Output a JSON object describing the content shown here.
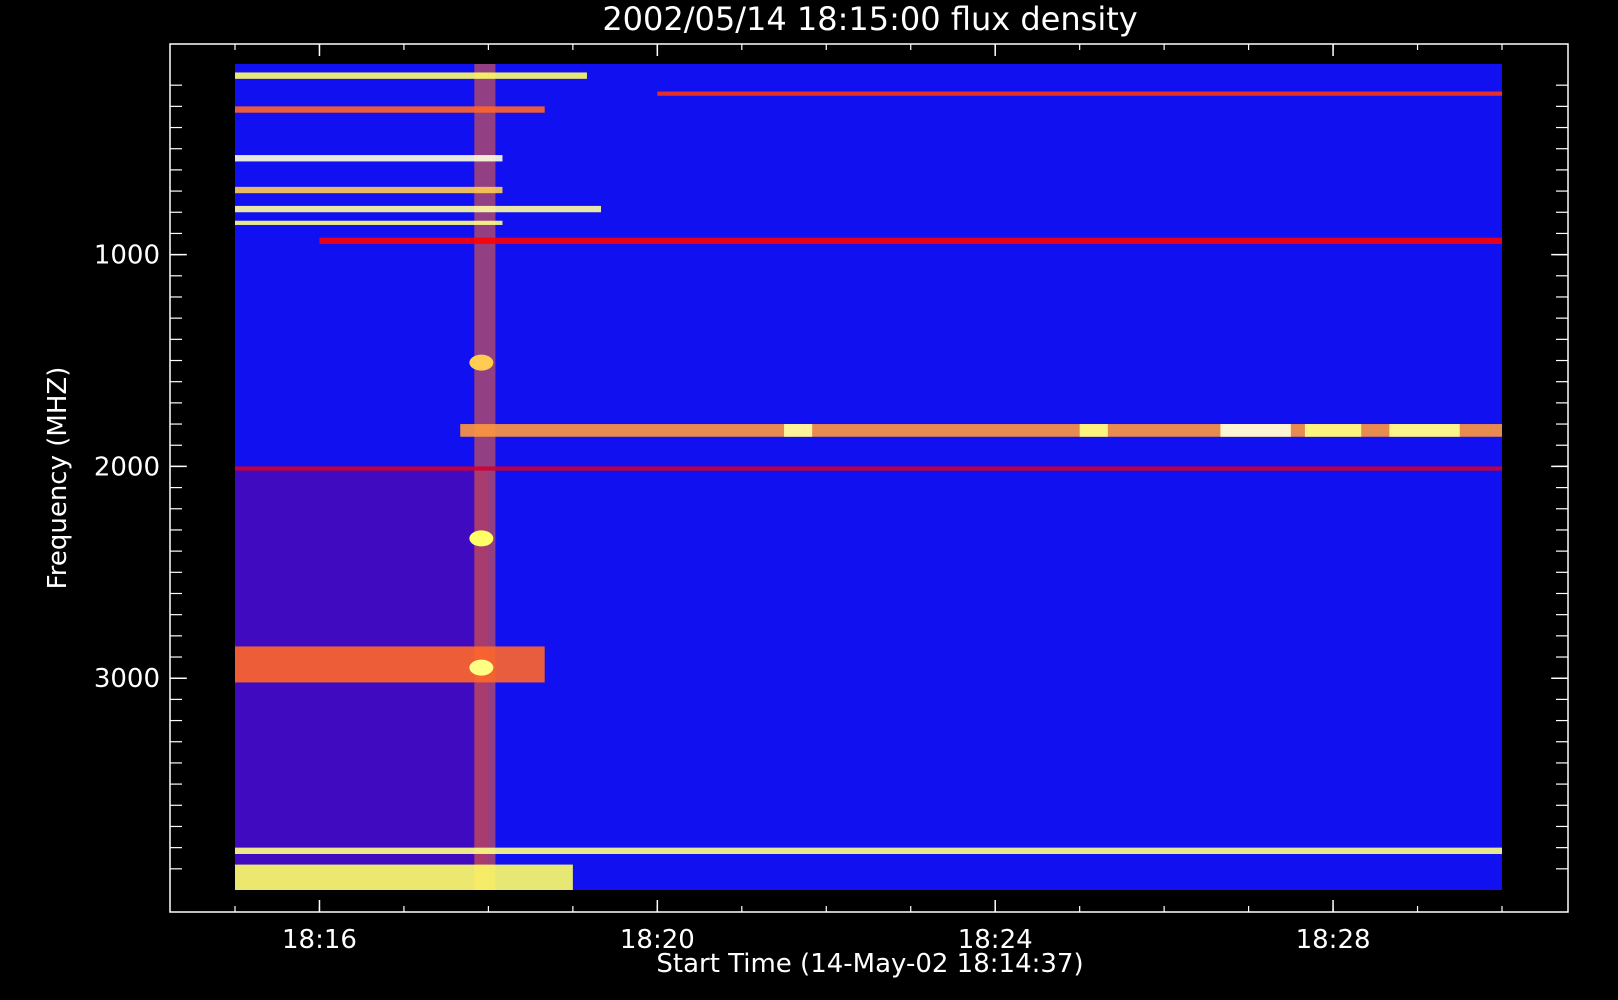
{
  "chart_data": {
    "type": "heatmap",
    "title": "2002/05/14 18:15:00 flux density",
    "xlabel": "Start Time (14-May-02 18:14:37)",
    "ylabel": "Frequency (MHZ)",
    "x_range": [
      "18:15:00",
      "18:30:00"
    ],
    "y_range_mhz": [
      100,
      4000
    ],
    "y_inverted": true,
    "x_ticks": [
      {
        "value": "18:16",
        "label": "18:16"
      },
      {
        "value": "18:20",
        "label": "18:20"
      },
      {
        "value": "18:24",
        "label": "18:24"
      },
      {
        "value": "18:28",
        "label": "18:28"
      }
    ],
    "y_ticks": [
      {
        "value": 1000,
        "label": "1000"
      },
      {
        "value": 2000,
        "label": "2000"
      },
      {
        "value": 3000,
        "label": "3000"
      }
    ],
    "colormap": [
      "#000000",
      "#0000ff",
      "#ff0000",
      "#ffff66",
      "#ffffff"
    ],
    "background_level_color": "#1010f0",
    "features": [
      {
        "kind": "horizontal-band",
        "freq_mhz": [
          140,
          170
        ],
        "time": [
          "18:15:00",
          "18:19:10"
        ],
        "intensity": 0.75
      },
      {
        "kind": "horizontal-band",
        "freq_mhz": [
          300,
          330
        ],
        "time": [
          "18:15:00",
          "18:18:40"
        ],
        "intensity": 0.6
      },
      {
        "kind": "horizontal-band",
        "freq_mhz": [
          530,
          560
        ],
        "time": [
          "18:15:00",
          "18:18:10"
        ],
        "intensity": 0.95
      },
      {
        "kind": "horizontal-band",
        "freq_mhz": [
          680,
          710
        ],
        "time": [
          "18:15:00",
          "18:18:10"
        ],
        "intensity": 0.7
      },
      {
        "kind": "horizontal-band",
        "freq_mhz": [
          770,
          800
        ],
        "time": [
          "18:15:00",
          "18:19:20"
        ],
        "intensity": 0.85
      },
      {
        "kind": "horizontal-band",
        "freq_mhz": [
          840,
          860
        ],
        "time": [
          "18:15:00",
          "18:18:10"
        ],
        "intensity": 0.8
      },
      {
        "kind": "horizontal-band",
        "freq_mhz": [
          230,
          250
        ],
        "time": [
          "18:20:00",
          "18:30:00"
        ],
        "intensity": 0.55
      },
      {
        "kind": "horizontal-band",
        "freq_mhz": [
          920,
          950
        ],
        "time": [
          "18:16:00",
          "18:30:00"
        ],
        "intensity": 0.5
      },
      {
        "kind": "horizontal-band",
        "freq_mhz": [
          1800,
          1860
        ],
        "time": [
          "18:17:40",
          "18:30:00"
        ],
        "intensity": 0.65
      },
      {
        "kind": "horizontal-band",
        "freq_mhz": [
          1800,
          1860
        ],
        "time": [
          "18:21:30",
          "18:21:50"
        ],
        "intensity": 0.85
      },
      {
        "kind": "horizontal-band",
        "freq_mhz": [
          1800,
          1860
        ],
        "time": [
          "18:25:00",
          "18:25:20"
        ],
        "intensity": 0.8
      },
      {
        "kind": "horizontal-band",
        "freq_mhz": [
          1800,
          1860
        ],
        "time": [
          "18:26:40",
          "18:27:30"
        ],
        "intensity": 0.95
      },
      {
        "kind": "horizontal-band",
        "freq_mhz": [
          1800,
          1860
        ],
        "time": [
          "18:27:40",
          "18:28:20"
        ],
        "intensity": 0.8
      },
      {
        "kind": "horizontal-band",
        "freq_mhz": [
          1800,
          1860
        ],
        "time": [
          "18:28:40",
          "18:29:30"
        ],
        "intensity": 0.82
      },
      {
        "kind": "horizontal-band",
        "freq_mhz": [
          2000,
          2020
        ],
        "time": [
          "18:15:00",
          "18:30:00"
        ],
        "intensity": 0.45
      },
      {
        "kind": "horizontal-band",
        "freq_mhz": [
          2850,
          3020
        ],
        "time": [
          "18:15:00",
          "18:18:40"
        ],
        "intensity": 0.6
      },
      {
        "kind": "horizontal-band",
        "freq_mhz": [
          3800,
          3830
        ],
        "time": [
          "18:15:00",
          "18:30:00"
        ],
        "intensity": 0.8
      },
      {
        "kind": "horizontal-band",
        "freq_mhz": [
          3880,
          4000
        ],
        "time": [
          "18:15:00",
          "18:19:00"
        ],
        "intensity": 0.75
      },
      {
        "kind": "vertical-band",
        "time": [
          "18:17:50",
          "18:18:05"
        ],
        "freq_mhz": [
          100,
          4000
        ],
        "intensity": 0.6
      },
      {
        "kind": "spot",
        "time": "18:17:55",
        "freq_mhz": 1510,
        "intensity": 0.7
      },
      {
        "kind": "spot",
        "time": "18:17:55",
        "freq_mhz": 2340,
        "intensity": 0.75
      },
      {
        "kind": "spot",
        "time": "18:17:55",
        "freq_mhz": 2950,
        "intensity": 0.8
      },
      {
        "kind": "region",
        "time": [
          "18:15:00",
          "18:18:00"
        ],
        "freq_mhz": [
          2000,
          4000
        ],
        "intensity": 0.4
      }
    ],
    "grid": false,
    "legend": "none"
  }
}
